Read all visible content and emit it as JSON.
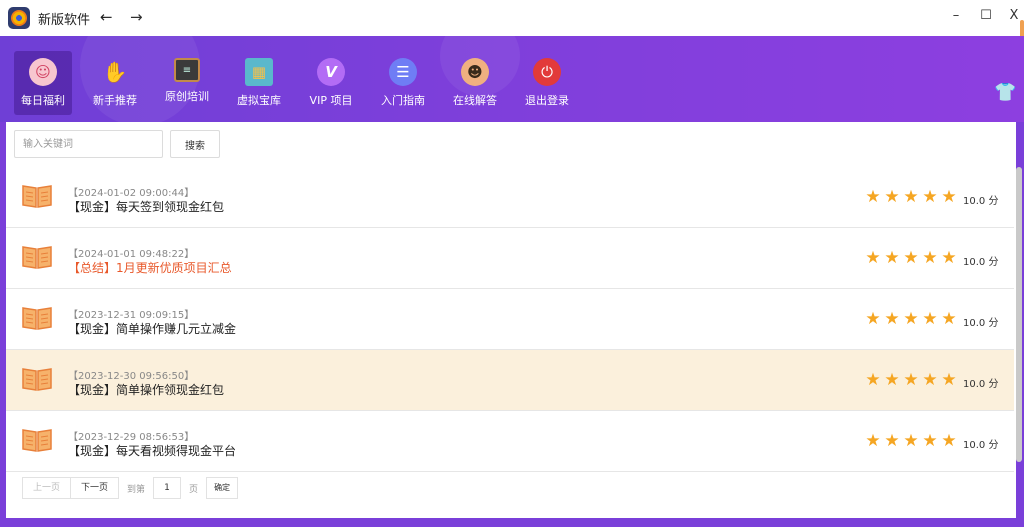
{
  "titlebar": {
    "app_title": "新版软件",
    "back_symbol": "←",
    "forward_symbol": "→",
    "minimize_symbol": "–",
    "maximize_symbol": "☐",
    "close_symbol": "X"
  },
  "nav": {
    "items": [
      {
        "label": "每日福利",
        "icon": "lucky-cat-icon",
        "color": "#f2a0b0"
      },
      {
        "label": "新手推荐",
        "icon": "thumbs-up-icon",
        "color": "#f08a1e"
      },
      {
        "label": "原创培训",
        "icon": "blackboard-icon",
        "color": "#5a4030"
      },
      {
        "label": "虚拟宝库",
        "icon": "warehouse-icon",
        "color": "#49b4c8"
      },
      {
        "label": "VIP 项目",
        "icon": "vip-icon",
        "color": "#a052f0"
      },
      {
        "label": "入门指南",
        "icon": "document-icon",
        "color": "#5a6ff0"
      },
      {
        "label": "在线解答",
        "icon": "customer-service-icon",
        "color": "#e07a3a"
      },
      {
        "label": "退出登录",
        "icon": "power-icon",
        "color": "#e23a3a"
      }
    ],
    "active_index": 0
  },
  "search": {
    "placeholder": "输入关键词",
    "button_label": "搜索"
  },
  "list": {
    "items": [
      {
        "date": "【2024-01-02 09:00:44】",
        "title": "【现金】每天签到领现金红包",
        "score": "10.0 分",
        "rating": 5,
        "highlight": false,
        "title_color": "#222222"
      },
      {
        "date": "【2024-01-01 09:48:22】",
        "title": "【总结】1月更新优质项目汇总",
        "score": "10.0 分",
        "rating": 5,
        "highlight": false,
        "title_color": "#e8582a"
      },
      {
        "date": "【2023-12-31 09:09:15】",
        "title": "【现金】简单操作赚几元立减金",
        "score": "10.0 分",
        "rating": 5,
        "highlight": false,
        "title_color": "#222222"
      },
      {
        "date": "【2023-12-30 09:56:50】",
        "title": "【现金】简单操作领现金红包",
        "score": "10.0 分",
        "rating": 5,
        "highlight": true,
        "title_color": "#222222"
      },
      {
        "date": "【2023-12-29 08:56:53】",
        "title": "【现金】每天看视频得现金平台",
        "score": "10.0 分",
        "rating": 5,
        "highlight": false,
        "title_color": "#222222"
      }
    ]
  },
  "pagination": {
    "prev_label": "上一页",
    "next_label": "下一页",
    "goto_label": "到第",
    "page_value": "1",
    "page_unit": "页",
    "confirm_label": "确定"
  },
  "colors": {
    "header_gradient_start": "#6f3fd6",
    "header_gradient_end": "#8d3fe0",
    "star": "#f5a623",
    "highlight_row": "#fbf0dc",
    "accent_red": "#e8582a"
  }
}
